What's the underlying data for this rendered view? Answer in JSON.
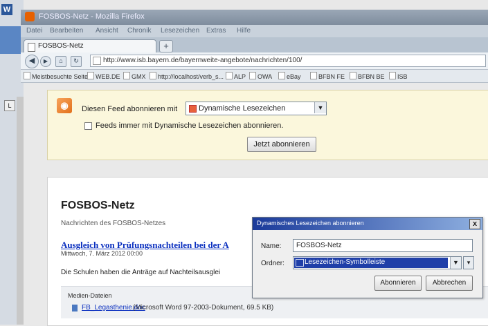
{
  "leftstrip": {
    "app_letter": "W",
    "side_letter": "L"
  },
  "window": {
    "title": "FOSBOS-Netz - Mozilla Firefox"
  },
  "menu": [
    "Datei",
    "Bearbeiten",
    "Ansicht",
    "Chronik",
    "Lesezeichen",
    "Extras",
    "Hilfe"
  ],
  "tab": {
    "label": "FOSBOS-Netz",
    "new_tab": "+"
  },
  "nav": {
    "url": "http://www.isb.bayern.de/bayernweite-angebote/nachrichten/100/"
  },
  "bookmarks": [
    "Meistbesuchte Seiten",
    "WEB.DE",
    "GMX",
    "http://localhost/verb_s...",
    "ALP",
    "OWA",
    "eBay",
    "BFBN FE",
    "BFBN BE",
    "ISB"
  ],
  "feed": {
    "subscribe_label": "Diesen Feed abonnieren mit",
    "reader": "Dynamische Lesezeichen",
    "always_label": "Feeds immer mit Dynamische Lesezeichen abonnieren.",
    "subscribe_button": "Jetzt abonnieren"
  },
  "page": {
    "title": "FOSBOS-Netz",
    "subtitle": "Nachrichten des FOSBOS-Netzes",
    "item_title": "Ausgleich von Prüfungsnachteilen bei der A",
    "item_date": "Mittwoch, 7. März 2012 00:00",
    "item_text": "Die Schulen haben die Anträge auf Nachteilsausglei",
    "media_heading": "Medien-Dateien",
    "media_link": "FB_Legasthenie.doc",
    "media_meta": "(Microsoft Word 97-2003-Dokument, 69.5 KB)"
  },
  "dialog": {
    "title": "Dynamisches Lesezeichen abonnieren",
    "close": "x",
    "name_label": "Name:",
    "name_value": "FOSBOS-Netz",
    "folder_label": "Ordner:",
    "folder_value": "Lesezeichen-Symbolleiste",
    "ok_button": "Abonnieren",
    "cancel_button": "Abbrechen"
  }
}
